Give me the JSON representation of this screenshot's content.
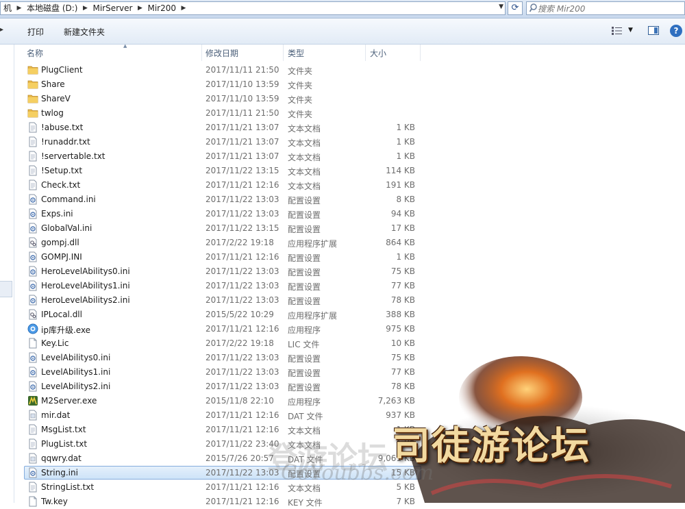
{
  "address": {
    "crumbs": [
      "机",
      "本地磁盘 (D:)",
      "MirServer",
      "Mir200"
    ]
  },
  "search": {
    "placeholder": "搜索 Mir200"
  },
  "toolbar": {
    "print_label": "打印",
    "new_folder_label": "新建文件夹"
  },
  "columns": {
    "name": "名称",
    "date": "修改日期",
    "type": "类型",
    "size": "大小"
  },
  "files": [
    {
      "name": "PlugClient",
      "date": "2017/11/11 21:50",
      "type": "文件夹",
      "size": "",
      "icon": "folder-icon"
    },
    {
      "name": "Share",
      "date": "2017/11/10 13:59",
      "type": "文件夹",
      "size": "",
      "icon": "folder-icon"
    },
    {
      "name": "ShareV",
      "date": "2017/11/10 13:59",
      "type": "文件夹",
      "size": "",
      "icon": "folder-icon"
    },
    {
      "name": "twlog",
      "date": "2017/11/11 21:50",
      "type": "文件夹",
      "size": "",
      "icon": "folder-icon"
    },
    {
      "name": "!abuse.txt",
      "date": "2017/11/21 13:07",
      "type": "文本文档",
      "size": "1 KB",
      "icon": "text-file-icon"
    },
    {
      "name": "!runaddr.txt",
      "date": "2017/11/21 13:07",
      "type": "文本文档",
      "size": "1 KB",
      "icon": "text-file-icon"
    },
    {
      "name": "!servertable.txt",
      "date": "2017/11/21 13:07",
      "type": "文本文档",
      "size": "1 KB",
      "icon": "text-file-icon"
    },
    {
      "name": "!Setup.txt",
      "date": "2017/11/22 13:15",
      "type": "文本文档",
      "size": "114 KB",
      "icon": "text-file-icon"
    },
    {
      "name": "Check.txt",
      "date": "2017/11/21 12:16",
      "type": "文本文档",
      "size": "191 KB",
      "icon": "text-file-icon"
    },
    {
      "name": "Command.ini",
      "date": "2017/11/22 13:03",
      "type": "配置设置",
      "size": "8 KB",
      "icon": "config-file-icon"
    },
    {
      "name": "Exps.ini",
      "date": "2017/11/22 13:03",
      "type": "配置设置",
      "size": "94 KB",
      "icon": "config-file-icon"
    },
    {
      "name": "GlobalVal.ini",
      "date": "2017/11/22 13:15",
      "type": "配置设置",
      "size": "17 KB",
      "icon": "config-file-icon"
    },
    {
      "name": "gompj.dll",
      "date": "2017/2/22 19:18",
      "type": "应用程序扩展",
      "size": "864 KB",
      "icon": "dll-file-icon"
    },
    {
      "name": "GOMPJ.INI",
      "date": "2017/11/21 12:16",
      "type": "配置设置",
      "size": "1 KB",
      "icon": "config-file-icon"
    },
    {
      "name": "HeroLevelAbilitys0.ini",
      "date": "2017/11/22 13:03",
      "type": "配置设置",
      "size": "75 KB",
      "icon": "config-file-icon"
    },
    {
      "name": "HeroLevelAbilitys1.ini",
      "date": "2017/11/22 13:03",
      "type": "配置设置",
      "size": "77 KB",
      "icon": "config-file-icon"
    },
    {
      "name": "HeroLevelAbilitys2.ini",
      "date": "2017/11/22 13:03",
      "type": "配置设置",
      "size": "78 KB",
      "icon": "config-file-icon"
    },
    {
      "name": "IPLocal.dll",
      "date": "2015/5/22 10:29",
      "type": "应用程序扩展",
      "size": "388 KB",
      "icon": "dll-file-icon"
    },
    {
      "name": "ip库升级.exe",
      "date": "2017/11/21 12:16",
      "type": "应用程序",
      "size": "975 KB",
      "icon": "exe-file-icon"
    },
    {
      "name": "Key.Lic",
      "date": "2017/2/22 19:18",
      "type": "LIC 文件",
      "size": "10 KB",
      "icon": "blank-file-icon"
    },
    {
      "name": "LevelAbilitys0.ini",
      "date": "2017/11/22 13:03",
      "type": "配置设置",
      "size": "75 KB",
      "icon": "config-file-icon"
    },
    {
      "name": "LevelAbilitys1.ini",
      "date": "2017/11/22 13:03",
      "type": "配置设置",
      "size": "77 KB",
      "icon": "config-file-icon"
    },
    {
      "name": "LevelAbilitys2.ini",
      "date": "2017/11/22 13:03",
      "type": "配置设置",
      "size": "78 KB",
      "icon": "config-file-icon"
    },
    {
      "name": "M2Server.exe",
      "date": "2015/11/8 22:10",
      "type": "应用程序",
      "size": "7,263 KB",
      "icon": "m2server-app-icon"
    },
    {
      "name": "mir.dat",
      "date": "2017/11/21 12:16",
      "type": "DAT 文件",
      "size": "937 KB",
      "icon": "dat-file-icon"
    },
    {
      "name": "MsgList.txt",
      "date": "2017/11/21 12:16",
      "type": "文本文档",
      "size": "1 KB",
      "icon": "text-file-icon"
    },
    {
      "name": "PlugList.txt",
      "date": "2017/11/22 23:40",
      "type": "文本文档",
      "size": "1 KB",
      "icon": "text-file-icon"
    },
    {
      "name": "qqwry.dat",
      "date": "2015/7/26 20:57",
      "type": "DAT 文件",
      "size": "9,061 KB",
      "icon": "dat-file-icon"
    },
    {
      "name": "String.ini",
      "date": "2017/11/22 13:03",
      "type": "配置设置",
      "size": "15 KB",
      "icon": "config-file-icon",
      "selected": true
    },
    {
      "name": "StringList.txt",
      "date": "2017/11/21 12:16",
      "type": "文本文档",
      "size": "5 KB",
      "icon": "text-file-icon"
    },
    {
      "name": "Tw.key",
      "date": "2017/11/21 12:16",
      "type": "KEY 文件",
      "size": "7 KB",
      "icon": "blank-file-icon"
    }
  ],
  "watermark": {
    "logo": "司徒游论坛",
    "site": "GoYoubbs.com",
    "site_cn": "登游论坛"
  }
}
